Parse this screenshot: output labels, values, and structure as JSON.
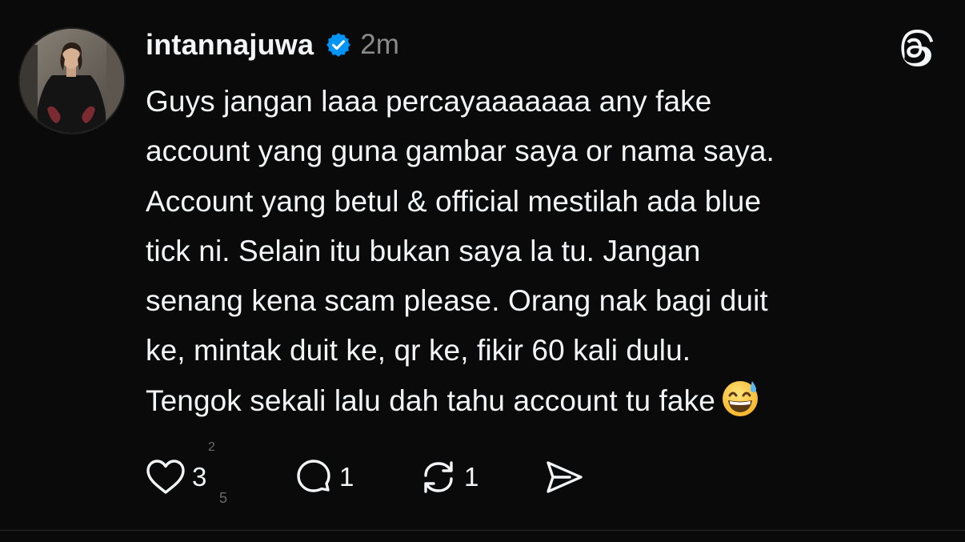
{
  "post": {
    "username": "intannajuwa",
    "time": "2m",
    "lines": [
      "Guys jangan laaa percayaaaaaaa any fake",
      "account yang guna gambar saya or nama saya.",
      "Account yang betul & official mestilah ada blue",
      "tick ni. Selain itu bukan saya la tu. Jangan",
      "senang kena scam please. Orang nak bagi duit",
      "ke, mintak duit ke, qr ke, fikir 60 kali dulu.",
      "Tengok sekali lalu dah tahu account tu fake"
    ],
    "icons": {
      "verified": "verified-badge-icon",
      "logo": "threads-logo-icon",
      "emoji": "grinning-face-with-sweat-emoji"
    }
  },
  "actions": {
    "like_count": "3",
    "like_roll_top": "2",
    "like_roll_bottom": "5",
    "reply_count": "1",
    "repost_count": "1",
    "icons": [
      "heart-icon",
      "comment-icon",
      "repost-icon",
      "share-icon"
    ]
  },
  "colors": {
    "background": "#0a0a0a",
    "text": "#f3f5f7",
    "muted": "#8a8a8a",
    "verified": "#0095f6"
  }
}
